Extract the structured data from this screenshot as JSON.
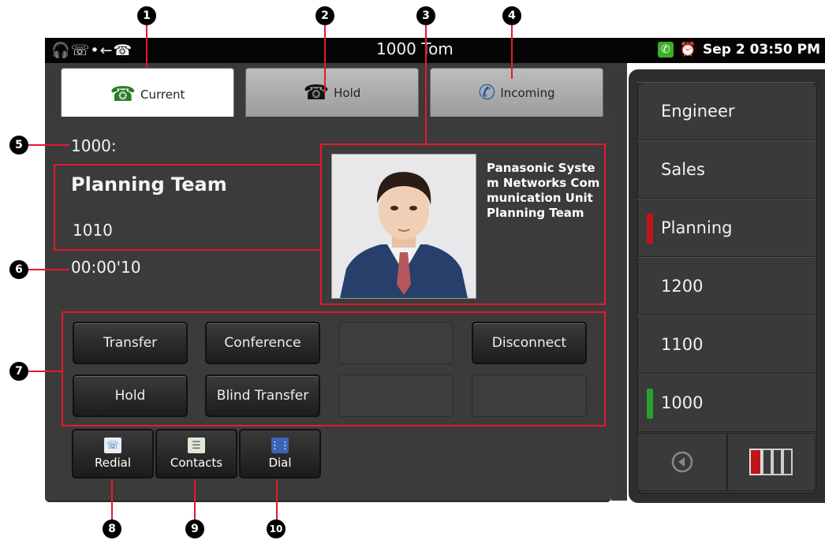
{
  "status_bar": {
    "title": "1000  Tom",
    "datetime": "Sep 2 03:50 PM"
  },
  "tabs": [
    {
      "label": "Current",
      "active": true
    },
    {
      "label": "Hold",
      "active": false
    },
    {
      "label": "Incoming",
      "active": false
    }
  ],
  "call": {
    "extension": "1000:",
    "name": "Planning Team",
    "number": "1010",
    "duration": "00:00'10",
    "company": "Panasonic System Networks Communication Unit Planning Team"
  },
  "buttons": {
    "transfer": "Transfer",
    "conference": "Conference",
    "disconnect": "Disconnect",
    "hold": "Hold",
    "blind_transfer": "Blind Transfer"
  },
  "shortcuts": {
    "redial": "Redial",
    "contacts": "Contacts",
    "dial": "Dial"
  },
  "side_panel": [
    {
      "label": "Engineer",
      "indicator": ""
    },
    {
      "label": "Sales",
      "indicator": ""
    },
    {
      "label": "Planning",
      "indicator": "#c0161b"
    },
    {
      "label": "1200",
      "indicator": ""
    },
    {
      "label": "1100",
      "indicator": ""
    },
    {
      "label": "1000",
      "indicator": "#28a22a"
    }
  ],
  "callouts": [
    "1",
    "2",
    "3",
    "4",
    "5",
    "6",
    "7",
    "8",
    "9",
    "10"
  ],
  "colors": {
    "callout_line": "#e5192c",
    "panel_bg": "#3b3b3b",
    "status_bar_bg": "#050505"
  }
}
